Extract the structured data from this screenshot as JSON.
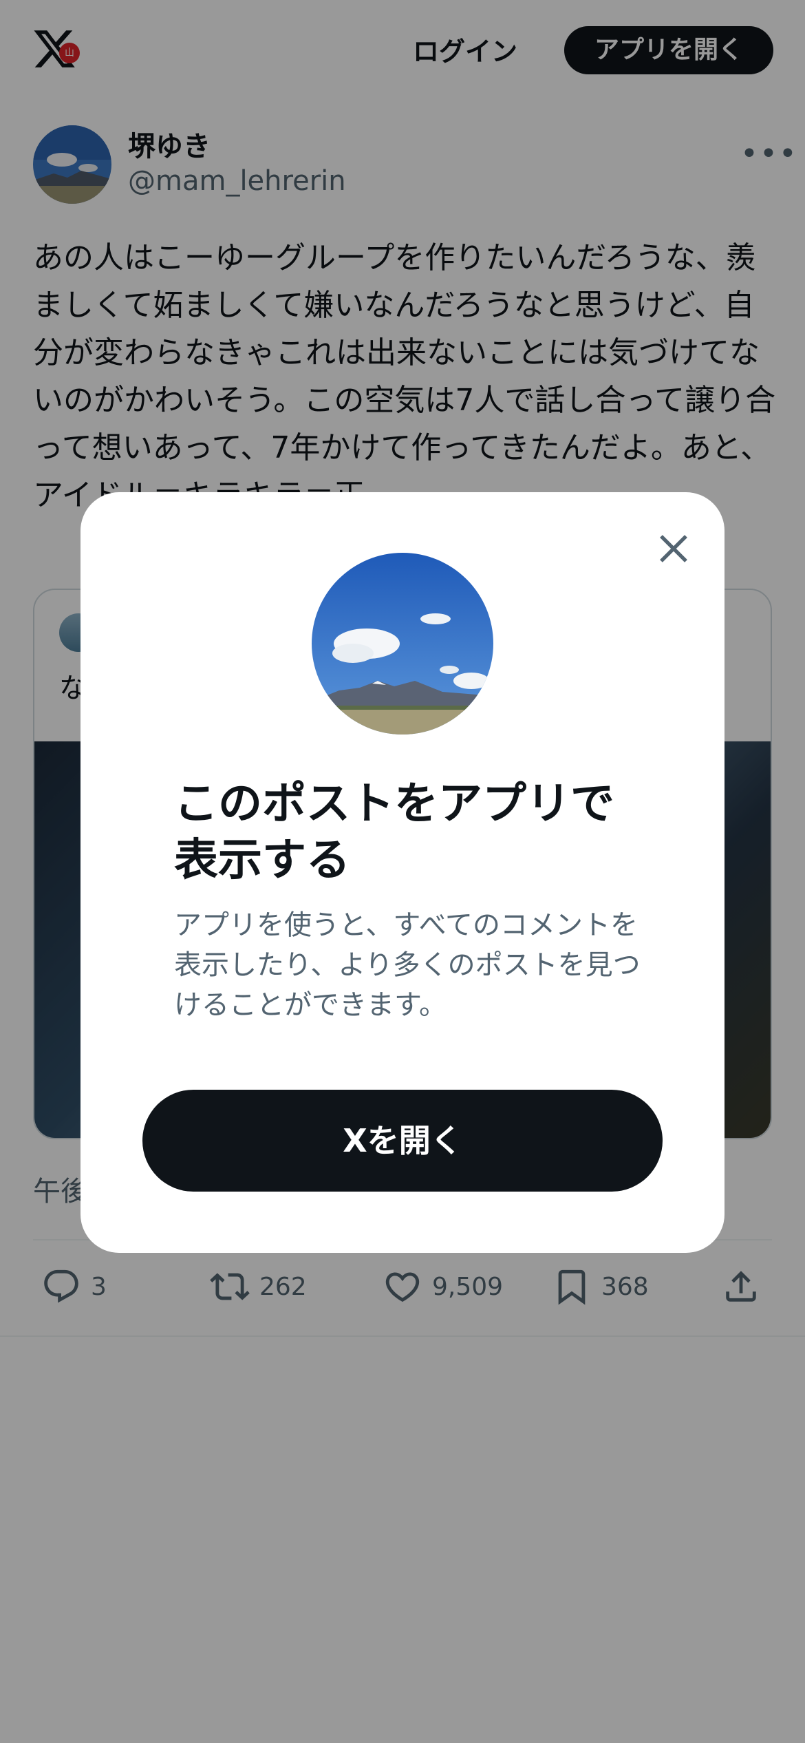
{
  "header": {
    "logo_icon": "x-logo-icon",
    "badge_text": "山",
    "login_label": "ログイン",
    "open_app_label": "アプリを開く"
  },
  "tweet": {
    "display_name": "堺ゆき",
    "handle": "@mam_lehrerin",
    "more_label": "•••",
    "text": "あの人はこーゆーグループを作りたいんだろうな、羨ましくて妬ましくて嫌いなんだろうなと思うけど、自分が変わらなきゃこれは出来ないことには気づけてないのがかわいそう。この空気は7人で話し合って譲り合って想いあって、7年かけて作ってきたんだよ。あと、アイドル＝キラキラ＝正",
    "quote_text": "な",
    "timestamp": "午後",
    "stats": {
      "replies": "3",
      "retweets": "262",
      "likes": "9,509",
      "bookmarks": "368"
    }
  },
  "modal": {
    "title": "このポストをアプリで表示する",
    "description": "アプリを使うと、すべてのコメントを表示したり、より多くのポストを見つけることができます。",
    "cta_label": "Xを開く",
    "close_icon": "close-icon"
  },
  "colors": {
    "primary_dark": "#0f1419",
    "secondary_text": "#536471",
    "overlay": "rgba(0,0,0,0.4)"
  }
}
